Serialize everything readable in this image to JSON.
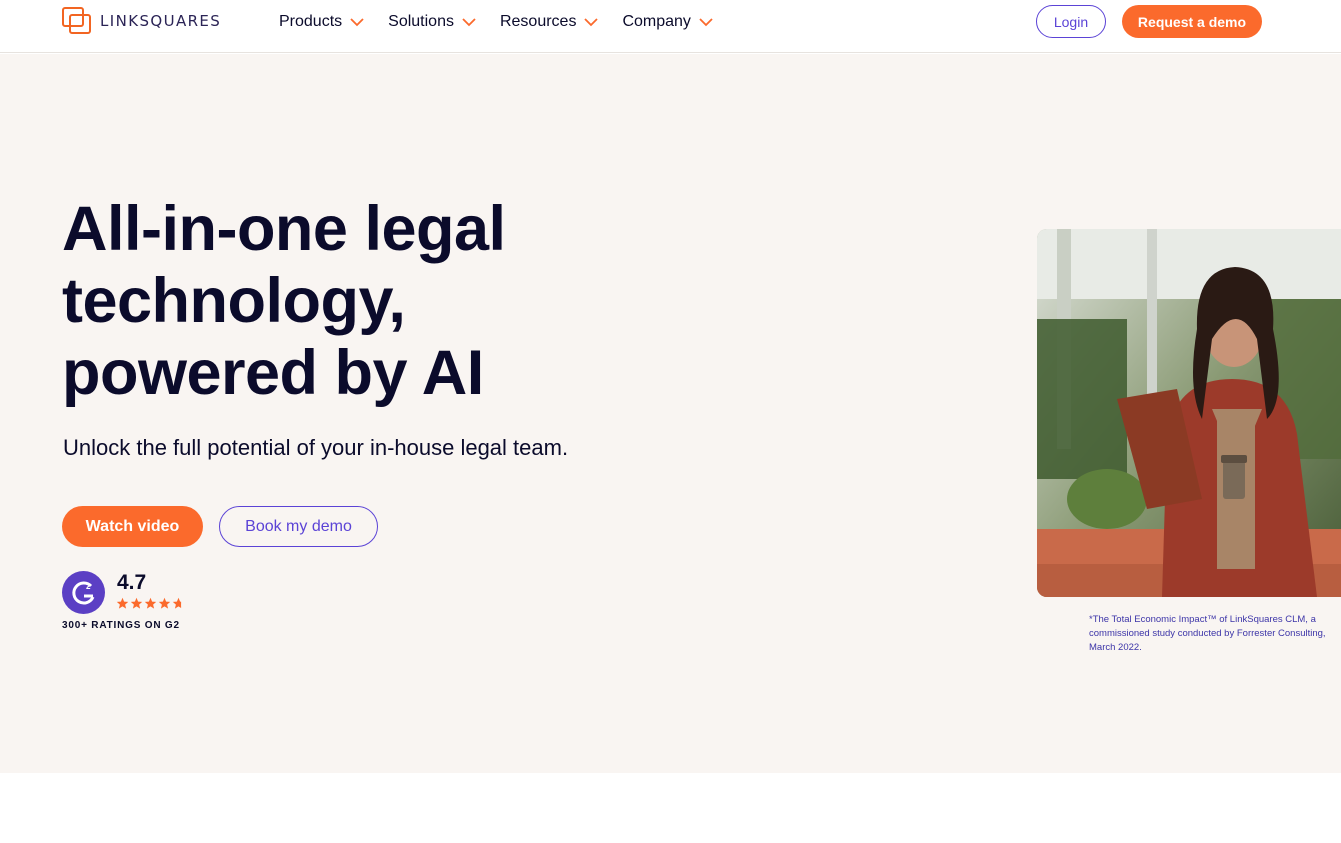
{
  "nav": {
    "logo_text": "LINKSQUARES",
    "menu": [
      {
        "label": "Products"
      },
      {
        "label": "Solutions"
      },
      {
        "label": "Resources"
      },
      {
        "label": "Company"
      }
    ],
    "login_label": "Login",
    "request_demo_label": "Request a demo"
  },
  "hero": {
    "headline_lines": [
      "All-in-one legal",
      "technology,",
      "powered by AI"
    ],
    "subheadline": "Unlock the full potential of your in-house legal team.",
    "watch_video_label": "Watch video",
    "book_demo_label": "Book my demo",
    "rating": {
      "value": "4.7",
      "stars": 4.7,
      "caption": "300+ RATINGS ON G2",
      "badge": "G2"
    },
    "footnote": "*The Total Economic Impact™ of LinkSquares CLM, a commissioned study conducted by Forrester Consulting, March 2022."
  },
  "colors": {
    "accent_orange": "#fb6a2c",
    "accent_purple": "#5b43d6",
    "hero_background": "#f9f5f2",
    "text_dark": "#0b0b2b"
  }
}
